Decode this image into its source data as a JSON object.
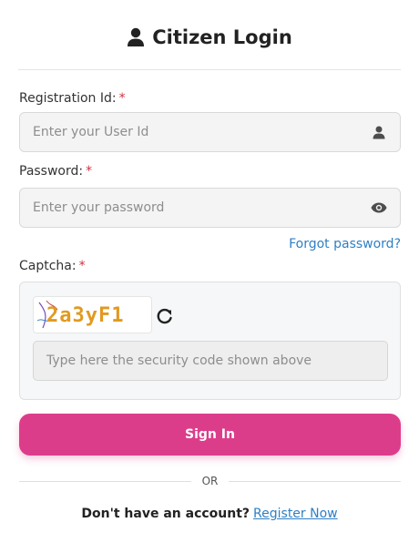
{
  "header": {
    "title": "Citizen Login",
    "icon": "user-icon"
  },
  "form": {
    "registration": {
      "label": "Registration Id:",
      "required_mark": "*",
      "placeholder": "Enter your User Id",
      "icon": "user-icon"
    },
    "password": {
      "label": "Password:",
      "required_mark": "*",
      "placeholder": "Enter your password",
      "icon": "eye-icon"
    },
    "forgot_link": "Forgot password?",
    "captcha": {
      "label": "Captcha:",
      "required_mark": "*",
      "code": "2a3yF1",
      "placeholder": "Type here the security code shown above",
      "refresh_icon": "refresh-icon"
    },
    "signin_label": "Sign In",
    "or_text": "OR",
    "no_account_text": "Don't have an account?",
    "register_link": "Register Now"
  },
  "colors": {
    "accent": "#dc3d8b",
    "link": "#2f7fc4",
    "required": "#d0303f"
  }
}
